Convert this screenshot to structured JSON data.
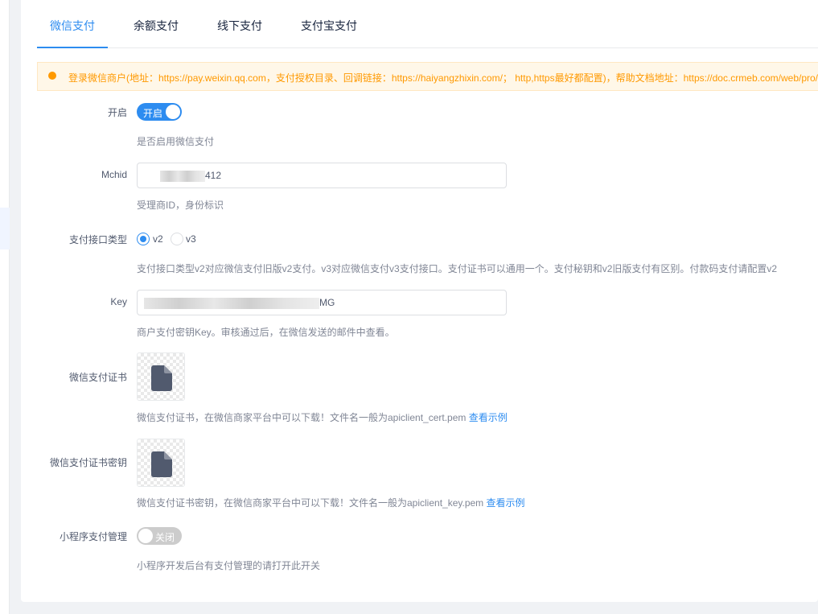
{
  "tabs": [
    {
      "label": "微信支付",
      "active": true
    },
    {
      "label": "余额支付",
      "active": false
    },
    {
      "label": "线下支付",
      "active": false
    },
    {
      "label": "支付宝支付",
      "active": false
    }
  ],
  "alert": {
    "text": "登录微信商户(地址：https://pay.weixin.qq.com，支付授权目录、回调链接：https://haiyangzhixin.com/； http,https最好都配置)，帮助文档地址：https://doc.crmeb.com/web/pro/"
  },
  "form": {
    "enable": {
      "label": "开启",
      "switch_text": "开启",
      "on": true,
      "help": "是否启用微信支付"
    },
    "mchid": {
      "label": "Mchid",
      "value_suffix": "412",
      "help": "受理商ID，身份标识"
    },
    "api_type": {
      "label": "支付接口类型",
      "options": [
        {
          "label": "v2",
          "checked": true
        },
        {
          "label": "v3",
          "checked": false
        }
      ],
      "help": "支付接口类型v2对应微信支付旧版v2支付。v3对应微信支付v3支付接口。支付证书可以通用一个。支付秘钥和v2旧版支付有区别。付款码支付请配置v2"
    },
    "key": {
      "label": "Key",
      "value_suffix": "MG",
      "help": "商户支付密钥Key。审核通过后，在微信发送的邮件中查看。"
    },
    "cert": {
      "label": "微信支付证书",
      "icon": "file-icon",
      "help": "微信支付证书，在微信商家平台中可以下载！文件名一般为apiclient_cert.pem",
      "link": "查看示例"
    },
    "cert_key": {
      "label": "微信支付证书密钥",
      "icon": "file-icon",
      "help": "微信支付证书密钥，在微信商家平台中可以下载！文件名一般为apiclient_key.pem",
      "link": "查看示例"
    },
    "mini_program": {
      "label": "小程序支付管理",
      "switch_text": "关闭",
      "on": false,
      "help": "小程序开发后台有支付管理的请打开此开关"
    }
  },
  "colors": {
    "primary": "#2d8cf0",
    "warning": "#ff9900",
    "alert_bg": "#fff7e8"
  }
}
